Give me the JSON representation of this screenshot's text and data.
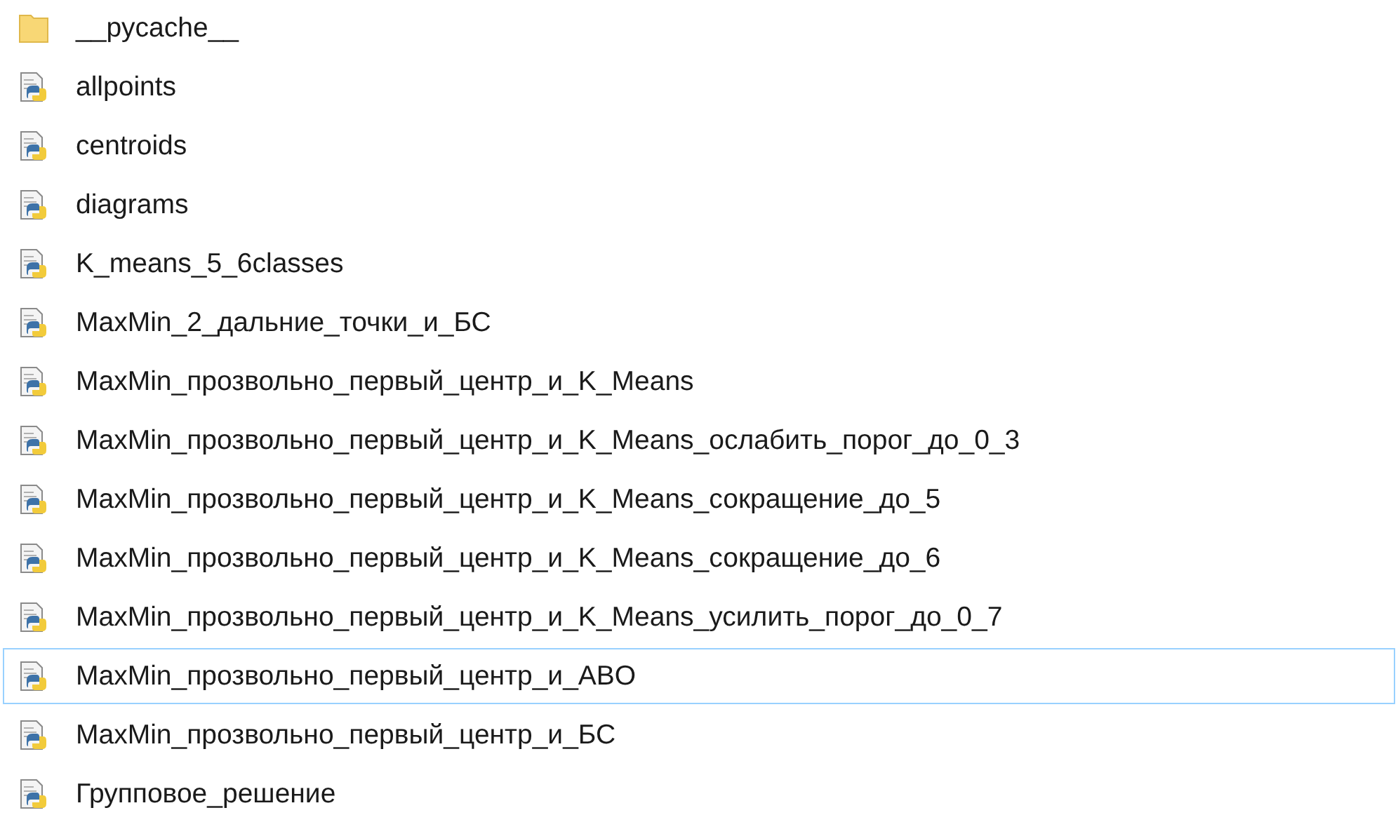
{
  "files": [
    {
      "kind": "folder",
      "name": "__pycache__",
      "selected": false
    },
    {
      "kind": "python",
      "name": "allpoints",
      "selected": false
    },
    {
      "kind": "python",
      "name": "centroids",
      "selected": false
    },
    {
      "kind": "python",
      "name": "diagrams",
      "selected": false
    },
    {
      "kind": "python",
      "name": "K_means_5_6classes",
      "selected": false
    },
    {
      "kind": "python",
      "name": "MaxMin_2_дальние_точки_и_БС",
      "selected": false
    },
    {
      "kind": "python",
      "name": "MaxMin_прозвольно_первый_центр_и_K_Means",
      "selected": false
    },
    {
      "kind": "python",
      "name": "MaxMin_прозвольно_первый_центр_и_K_Means_ослабить_порог_до_0_3",
      "selected": false
    },
    {
      "kind": "python",
      "name": "MaxMin_прозвольно_первый_центр_и_K_Means_сокращение_до_5",
      "selected": false
    },
    {
      "kind": "python",
      "name": "MaxMin_прозвольно_первый_центр_и_K_Means_сокращение_до_6",
      "selected": false
    },
    {
      "kind": "python",
      "name": "MaxMin_прозвольно_первый_центр_и_K_Means_усилить_порог_до_0_7",
      "selected": false
    },
    {
      "kind": "python",
      "name": "MaxMin_прозвольно_первый_центр_и_ABO",
      "selected": true
    },
    {
      "kind": "python",
      "name": "MaxMin_прозвольно_первый_центр_и_БС",
      "selected": false
    },
    {
      "kind": "python",
      "name": "Групповое_решение",
      "selected": false
    }
  ]
}
